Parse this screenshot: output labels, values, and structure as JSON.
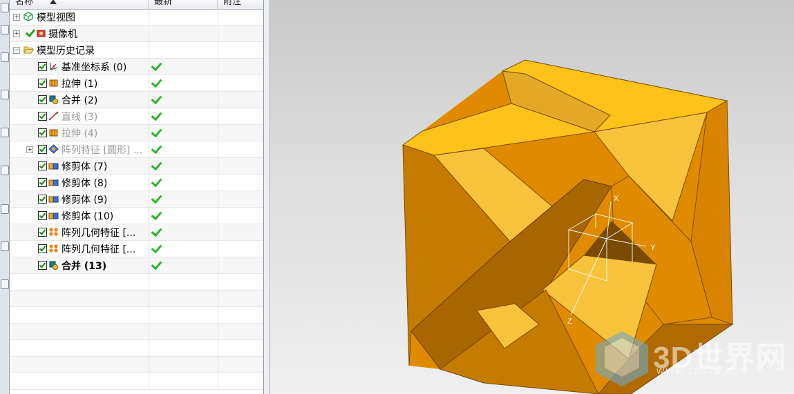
{
  "navigator": {
    "columns": {
      "name": "名称",
      "latest": "最新",
      "note": "附注"
    },
    "sort_icon": "sort-ascending-icon",
    "top_nodes": [
      {
        "label": "模型视图",
        "icon": "model-views-icon"
      },
      {
        "label": "摄像机",
        "icon": "camera-icon"
      },
      {
        "label": "模型历史记录",
        "icon": "open-folder-icon"
      }
    ],
    "features": [
      {
        "label": "基准坐标系 (0)",
        "icon": "datum-csys-icon",
        "state": "normal",
        "latest": "✔"
      },
      {
        "label": "拉伸 (1)",
        "icon": "extrude-icon",
        "state": "normal",
        "latest": "✔"
      },
      {
        "label": "合并 (2)",
        "icon": "unite-icon",
        "state": "normal",
        "latest": "✔"
      },
      {
        "label": "直线 (3)",
        "icon": "line-icon",
        "state": "dim",
        "latest": "✔"
      },
      {
        "label": "拉伸 (4)",
        "icon": "extrude-icon",
        "state": "dim",
        "latest": "✔"
      },
      {
        "label": "阵列特征 [圆形] ...",
        "icon": "pattern-feature-icon",
        "state": "dim",
        "latest": "✔"
      },
      {
        "label": "修剪体 (7)",
        "icon": "trim-body-icon",
        "state": "normal",
        "latest": "✔"
      },
      {
        "label": "修剪体 (8)",
        "icon": "trim-body-icon",
        "state": "normal",
        "latest": "✔"
      },
      {
        "label": "修剪体 (9)",
        "icon": "trim-body-icon",
        "state": "normal",
        "latest": "✔"
      },
      {
        "label": "修剪体 (10)",
        "icon": "trim-body-icon",
        "state": "normal",
        "latest": "✔"
      },
      {
        "label": "阵列几何特征 [...",
        "icon": "pattern-geometry-icon",
        "state": "normal",
        "latest": "✔"
      },
      {
        "label": "阵列几何特征 [...",
        "icon": "pattern-geometry-icon",
        "state": "normal",
        "latest": "✔"
      },
      {
        "label": "合并 (13)",
        "icon": "unite-icon",
        "state": "bold",
        "latest": "✔"
      }
    ]
  },
  "viewport": {
    "axis_labels": {
      "x": "X",
      "y": "Y",
      "z": "Z"
    },
    "model_colors": {
      "light": "#F6C33A",
      "mid": "#E08A00",
      "dark": "#A05F00",
      "top": "#FFC21A"
    },
    "background": "#DADADA"
  },
  "watermark": {
    "brand": "3D世界网",
    "url": "WWW.3DSJW.COM"
  }
}
